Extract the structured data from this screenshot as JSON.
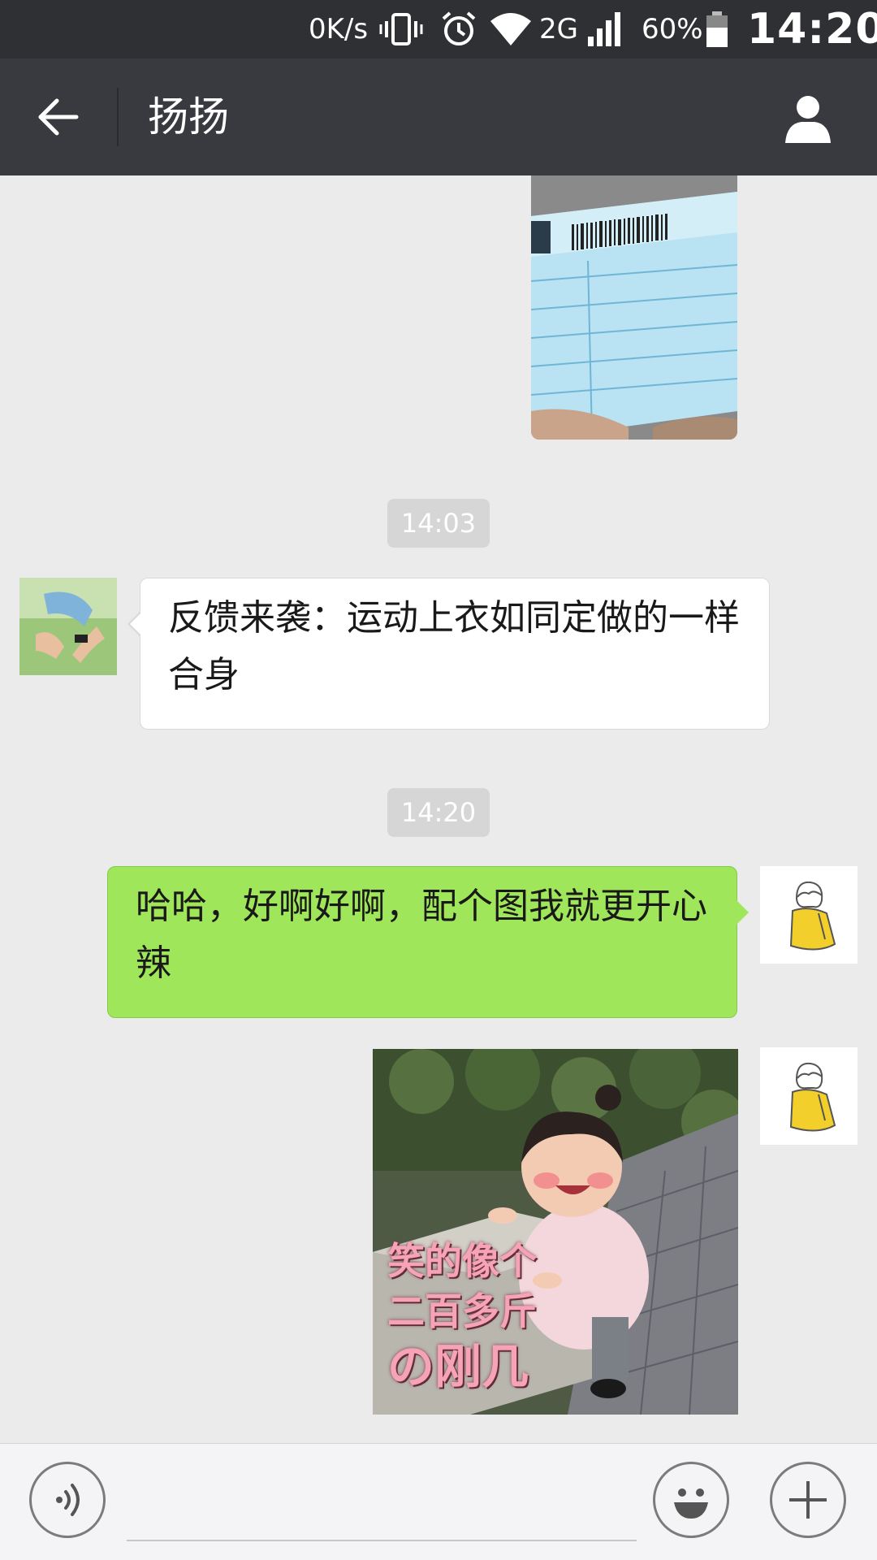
{
  "status_bar": {
    "net_speed": "0K/s",
    "network_type": "2G",
    "battery_percent": "60%",
    "clock": "14:20",
    "icons": [
      "vibrate-icon",
      "alarm-icon",
      "wifi-icon",
      "signal-icon",
      "battery-icon"
    ]
  },
  "header": {
    "title": "扬扬",
    "back_icon": "arrow-left-icon",
    "profile_icon": "person-icon"
  },
  "messages": [
    {
      "type": "image",
      "from": "self",
      "content": "shipping-label-photo"
    },
    {
      "type": "timestamp",
      "text": "14:03"
    },
    {
      "type": "text",
      "from": "contact",
      "text": "反馈来袭：运动上衣如同定做的一样合身"
    },
    {
      "type": "timestamp",
      "text": "14:20"
    },
    {
      "type": "text",
      "from": "self",
      "text": "哈哈，好啊好啊，配个图我就更开心辣"
    },
    {
      "type": "image",
      "from": "self",
      "content": "meme-photo",
      "caption_lines": [
        "笑的像个",
        "二百多斤",
        "の刚几"
      ]
    }
  ],
  "input_bar": {
    "voice_icon": "voice-icon",
    "emoji_icon": "smiley-icon",
    "plus_icon": "plus-icon",
    "placeholder": ""
  },
  "colors": {
    "status_bar_bg": "#2f3033",
    "title_bar_bg": "#393a3f",
    "chat_bg": "#ebebeb",
    "outgoing_bubble": "#9fe65a",
    "incoming_bubble": "#ffffff",
    "timestamp_bg": "#d6d6d6"
  }
}
